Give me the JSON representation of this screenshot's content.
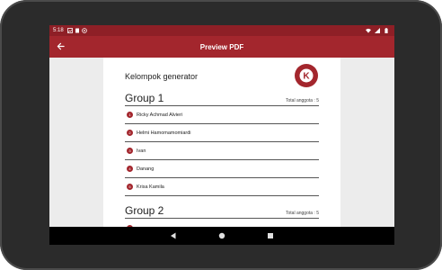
{
  "status_bar": {
    "time": "5:18",
    "left_icons": [
      "gallery-icon",
      "sd-card-icon",
      "at-sign-icon"
    ],
    "right_icons": [
      "wifi-icon",
      "signal-icon",
      "battery-icon"
    ]
  },
  "app_bar": {
    "title": "Preview PDF",
    "back_icon": "arrow-back-icon"
  },
  "document": {
    "title": "Kelompok generator",
    "logo_letter": "K",
    "groups": [
      {
        "name": "Group 1",
        "total_label": "Total anggota : 5",
        "members": [
          {
            "number": "1",
            "name": "Ricky Achmad Alvieri"
          },
          {
            "number": "2",
            "name": "Helmi Hamomamomiardi"
          },
          {
            "number": "3",
            "name": "Ivan"
          },
          {
            "number": "4",
            "name": "Danang"
          },
          {
            "number": "5",
            "name": "Krisa Kamila"
          }
        ]
      },
      {
        "name": "Group 2",
        "total_label": "Total anggota : 5",
        "members": []
      }
    ]
  },
  "nav_bar": {
    "icons": [
      "back-triangle-icon",
      "home-circle-icon",
      "recents-square-icon"
    ]
  },
  "colors": {
    "status_bar": "#8e1f26",
    "app_bar": "#a3262d",
    "accent": "#a3262d",
    "page_background": "#ececec"
  }
}
